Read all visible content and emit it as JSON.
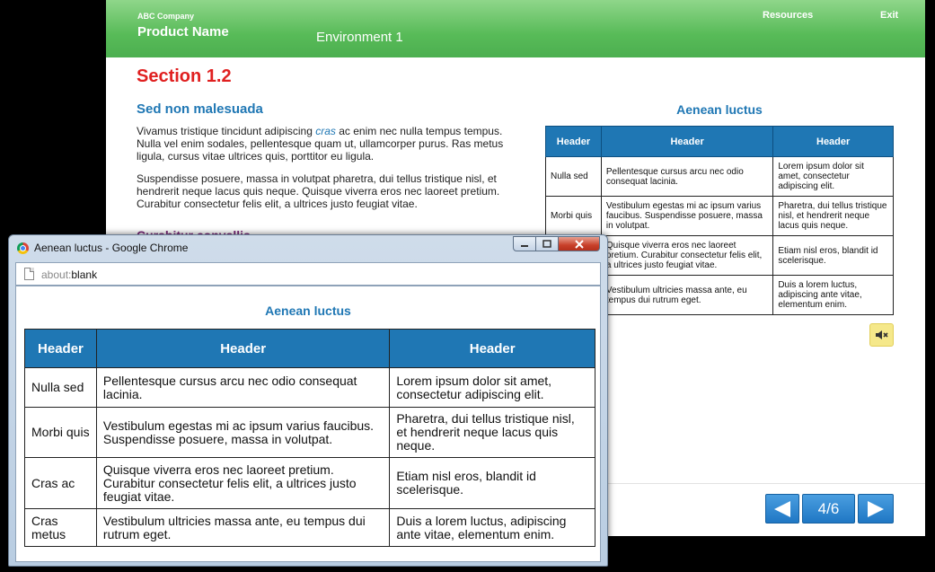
{
  "course": {
    "company": "ABC Company",
    "product": "Product Name",
    "environment": "Environment 1",
    "nav_links": {
      "resources": "Resources",
      "exit": "Exit"
    },
    "section_title": "Section 1.2",
    "subheading": "Sed non malesuada",
    "paragraph1_before": "Vivamus tristique tincidunt adipiscing ",
    "paragraph1_em": "cras",
    "paragraph1_after": " ac enim nec nulla tempus tempus. Nulla vel enim sodales, pellentesque quam ut, ullamcorper purus. Ras metus ligula, cursus vitae ultrices quis, porttitor eu ligula.",
    "paragraph2": "Suspendisse posuere, massa in volutpat pharetra, dui tellus tristique nisl, et hendrerit neque lacus quis neque. Quisque viverra eros nec laoreet pretium. Curabitur consectetur felis elit, a ultrices justo feugiat vitae.",
    "subheading2": "Curabitur convallis",
    "table_title": "Aenean luctus",
    "pagination": "4/6",
    "colors": {
      "header_green": "#58bb58",
      "accent_blue": "#1f77b4",
      "section_red": "#e02020"
    }
  },
  "table": {
    "headers": [
      "Header",
      "Header",
      "Header"
    ],
    "rows": [
      [
        "Nulla sed",
        "Pellentesque cursus arcu nec odio consequat lacinia.",
        "Lorem ipsum dolor sit amet, consectetur adipiscing elit."
      ],
      [
        "Morbi quis",
        "Vestibulum egestas mi ac ipsum varius faucibus. Suspendisse posuere, massa in volutpat.",
        "Pharetra, dui tellus tristique nisl, et hendrerit neque lacus quis neque."
      ],
      [
        "Cras ac",
        "Quisque viverra eros nec laoreet pretium. Curabitur consectetur felis elit, a ultrices justo feugiat vitae.",
        "Etiam nisl eros, blandit id scelerisque."
      ],
      [
        "Cras metus",
        "Vestibulum ultricies massa ante, eu tempus dui rutrum eget.",
        "Duis a lorem luctus, adipiscing ante vitae, elementum enim."
      ]
    ]
  },
  "popup": {
    "window_title": "Aenean luctus - Google Chrome",
    "url_scheme": "about:",
    "url_rest": "blank",
    "page_title": "Aenean luctus"
  },
  "icons": {
    "mute": "speaker-muted-icon",
    "prev": "arrow-left-icon",
    "next": "arrow-right-icon",
    "page": "page-icon",
    "browser": "chrome-logo-icon"
  }
}
